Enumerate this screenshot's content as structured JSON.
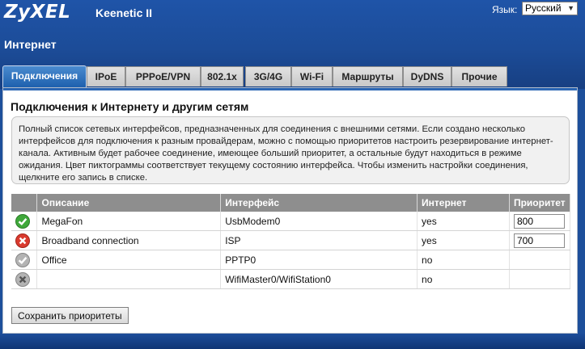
{
  "header": {
    "brand": "ZyXEL",
    "model": "Keenetic II",
    "language_label": "Язык:",
    "language_value": "Русский"
  },
  "page": {
    "section": "Интернет"
  },
  "tabs": [
    {
      "label": "Подключения",
      "active": true
    },
    {
      "label": "IPoE"
    },
    {
      "label": "PPPoE/VPN"
    },
    {
      "label": "802.1x"
    },
    {
      "label": "3G/4G"
    },
    {
      "label": "Wi-Fi"
    },
    {
      "label": "Маршруты"
    },
    {
      "label": "DyDNS"
    },
    {
      "label": "Прочие"
    }
  ],
  "panel": {
    "heading": "Подключения к Интернету и другим сетям",
    "info": "Полный список сетевых интерфейсов, предназначенных для соединения с внешними сетями. Если создано несколько интерфейсов для подключения к разным провайдерам, можно с помощью приоритетов настроить резервирование интернет-канала. Активным будет рабочее соединение, имеющее больший приоритет, а остальные будут находиться в режиме ожидания. Цвет пиктограммы соответствует текущему состоянию интерфейса. Чтобы изменить настройки соединения, щелкните его запись в списке."
  },
  "table": {
    "headers": {
      "description": "Описание",
      "interface": "Интерфейс",
      "internet": "Интернет",
      "priority": "Приоритет"
    },
    "rows": [
      {
        "status": "green-check-icon",
        "description": "MegaFon",
        "interface": "UsbModem0",
        "internet": "yes",
        "priority": "800"
      },
      {
        "status": "red-cross-icon",
        "description": "Broadband connection",
        "interface": "ISP",
        "internet": "yes",
        "priority": "700"
      },
      {
        "status": "gray-check-icon",
        "description": "Office",
        "interface": "PPTP0",
        "internet": "no",
        "priority": ""
      },
      {
        "status": "gray-cross-icon",
        "description": "",
        "interface": "WifiMaster0/WifiStation0",
        "internet": "no",
        "priority": ""
      }
    ]
  },
  "actions": {
    "save_label": "Сохранить приоритеты"
  },
  "colors": {
    "header_blue": "#1f54a8",
    "active_tab": "#2c6ab8",
    "table_header": "#8e8e8e",
    "status_green": "#3fa83a",
    "status_red": "#d93a2e",
    "status_gray": "#a8a8a8"
  }
}
